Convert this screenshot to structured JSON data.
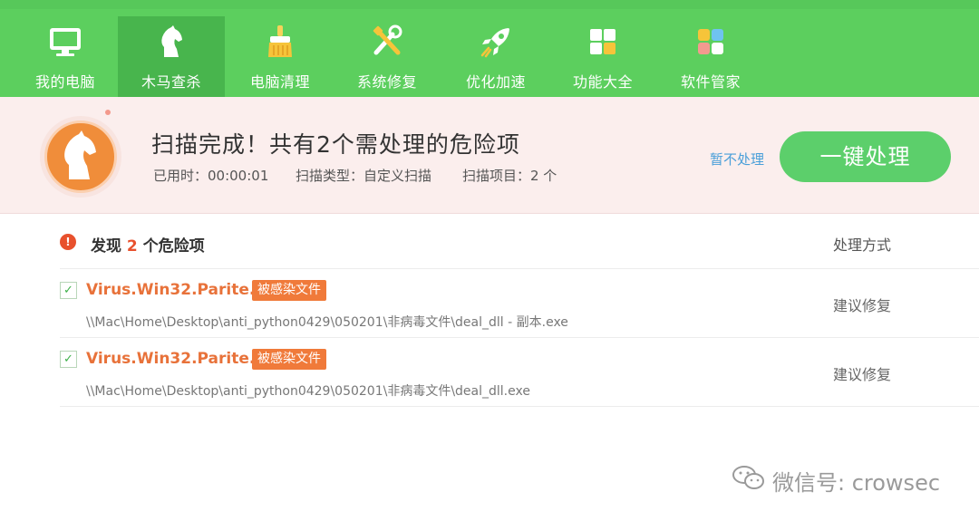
{
  "nav": [
    {
      "label": "我的电脑",
      "icon": "monitor-icon"
    },
    {
      "label": "木马查杀",
      "icon": "horse-icon",
      "active": true
    },
    {
      "label": "电脑清理",
      "icon": "broom-icon"
    },
    {
      "label": "系统修复",
      "icon": "tools-icon"
    },
    {
      "label": "优化加速",
      "icon": "rocket-icon"
    },
    {
      "label": "功能大全",
      "icon": "grid-icon"
    },
    {
      "label": "软件管家",
      "icon": "apps-icon"
    }
  ],
  "banner": {
    "title": "扫描完成！共有2个需处理的危险项",
    "elapsed": "已用时：00:00:01",
    "scan_type": "扫描类型：自定义扫描",
    "scan_items": "扫描项目：2 个",
    "skip_label": "暂不处理",
    "fix_label": "一键处理"
  },
  "list": {
    "found_prefix": "发现",
    "found_count": "2",
    "found_suffix": "个危险项",
    "column_header": "处理方式"
  },
  "threats": [
    {
      "name": "Virus.Win32.Parite.H",
      "tag": "被感染文件",
      "path": "\\\\Mac\\Home\\Desktop\\anti_python0429\\050201\\非病毒文件\\deal_dll - 副本.exe",
      "action": "建议修复",
      "checked": true
    },
    {
      "name": "Virus.Win32.Parite.H",
      "tag": "被感染文件",
      "path": "\\\\Mac\\Home\\Desktop\\anti_python0429\\050201\\非病毒文件\\deal_dll.exe",
      "action": "建议修复",
      "checked": true
    }
  ],
  "watermark": {
    "text": "微信号: crowsec",
    "icon": "wechat-icon"
  },
  "colors": {
    "nav_bg": "#5ccf5e",
    "nav_active": "#48b54d",
    "banner_bg": "#fbeeed",
    "danger": "#e8512d",
    "virus_name": "#e8723a",
    "button": "#5ccf6b",
    "link": "#4a9fd9"
  }
}
